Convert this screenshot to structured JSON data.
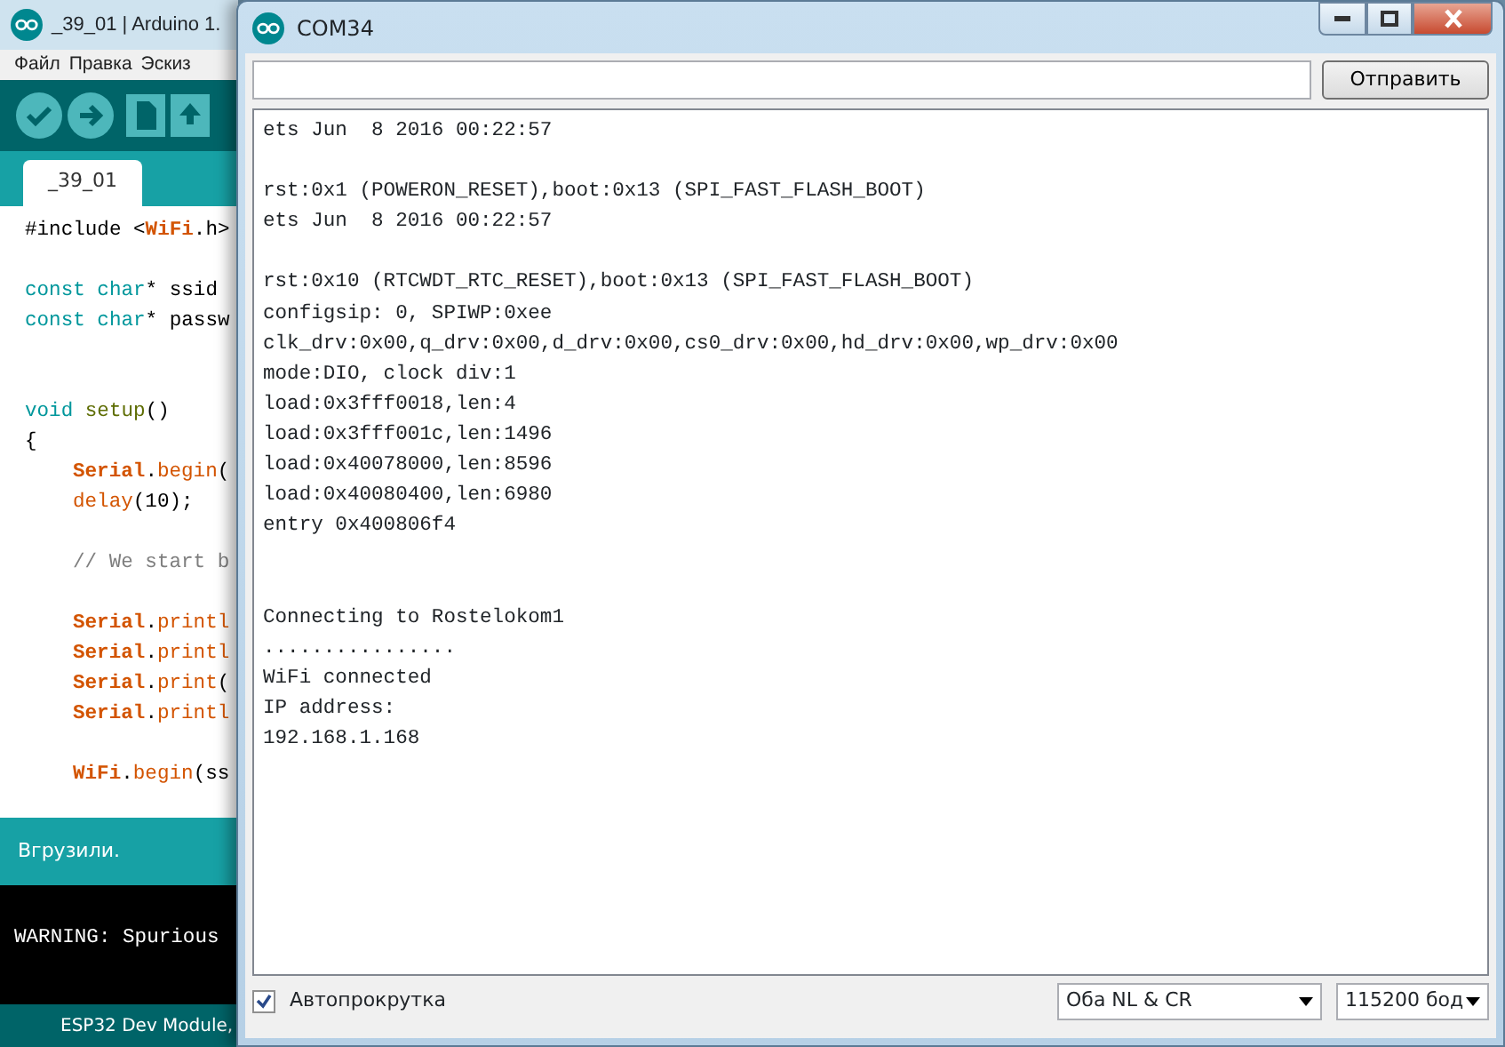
{
  "ide_window": {
    "title": "_39_01 | Arduino 1.",
    "menu": [
      "Файл",
      "Правка",
      "Эскиз"
    ],
    "tabs": [
      {
        "label": "_39_01",
        "selected": true
      }
    ],
    "code_lines": [
      {
        "kind": "code",
        "tokens": [
          {
            "text": "#include <",
            "kind": "plain"
          },
          {
            "text": "WiFi",
            "kind": "class"
          },
          {
            "text": ".h>",
            "kind": "plain"
          }
        ]
      },
      {
        "kind": "blank"
      },
      {
        "kind": "code",
        "tokens": [
          {
            "text": "const char",
            "kind": "keyword"
          },
          {
            "text": "* ssid",
            "kind": "plain"
          }
        ]
      },
      {
        "kind": "code",
        "tokens": [
          {
            "text": "const char",
            "kind": "keyword"
          },
          {
            "text": "* passw",
            "kind": "plain"
          }
        ]
      },
      {
        "kind": "blank"
      },
      {
        "kind": "blank"
      },
      {
        "kind": "code",
        "tokens": [
          {
            "text": "void",
            "kind": "keyword"
          },
          {
            "text": " setup",
            "kind": "function"
          },
          {
            "text": "()",
            "kind": "plain"
          }
        ]
      },
      {
        "kind": "code",
        "tokens": [
          {
            "text": "{",
            "kind": "plain"
          }
        ]
      },
      {
        "kind": "indented",
        "tokens": [
          {
            "text": "Serial",
            "kind": "class"
          },
          {
            "text": ".",
            "kind": "plain"
          },
          {
            "text": "begin",
            "kind": "method"
          },
          {
            "text": "(",
            "kind": "plain"
          }
        ]
      },
      {
        "kind": "indented",
        "tokens": [
          {
            "text": "delay",
            "kind": "method"
          },
          {
            "text": "(10);",
            "kind": "plain"
          }
        ]
      },
      {
        "kind": "blank"
      },
      {
        "kind": "indented",
        "tokens": [
          {
            "text": "// We start b",
            "kind": "comment"
          }
        ]
      },
      {
        "kind": "blank"
      },
      {
        "kind": "indented",
        "tokens": [
          {
            "text": "Serial",
            "kind": "class"
          },
          {
            "text": ".",
            "kind": "plain"
          },
          {
            "text": "printl",
            "kind": "method"
          }
        ]
      },
      {
        "kind": "indented",
        "tokens": [
          {
            "text": "Serial",
            "kind": "class"
          },
          {
            "text": ".",
            "kind": "plain"
          },
          {
            "text": "printl",
            "kind": "method"
          }
        ]
      },
      {
        "kind": "indented",
        "tokens": [
          {
            "text": "Serial",
            "kind": "class"
          },
          {
            "text": ".",
            "kind": "plain"
          },
          {
            "text": "print",
            "kind": "method"
          },
          {
            "text": "(",
            "kind": "plain"
          }
        ]
      },
      {
        "kind": "indented",
        "tokens": [
          {
            "text": "Serial",
            "kind": "class"
          },
          {
            "text": ".",
            "kind": "plain"
          },
          {
            "text": "printl",
            "kind": "method"
          }
        ]
      },
      {
        "kind": "blank"
      },
      {
        "kind": "indented",
        "tokens": [
          {
            "text": "WiFi",
            "kind": "class"
          },
          {
            "text": ".",
            "kind": "plain"
          },
          {
            "text": "begin",
            "kind": "method"
          },
          {
            "text": "(ss",
            "kind": "plain"
          }
        ]
      }
    ],
    "status": "Вгрузили.",
    "console_lines": [
      "WARNING: Spurious"
    ],
    "board": "ESP32 Dev Module,"
  },
  "serial_window": {
    "title": "COM34",
    "send_button": "Отправить",
    "output": [
      {
        "kind": "text",
        "text": "ets Jun  8 2016 00:22:57"
      },
      {
        "kind": "blank"
      },
      {
        "kind": "text",
        "text": "rst:0x1 (POWERON_RESET),boot:0x13 (SPI_FAST_FLASH_BOOT)"
      },
      {
        "kind": "text",
        "text": "ets Jun  8 2016 00:22:57"
      },
      {
        "kind": "blank"
      },
      {
        "kind": "text",
        "text": "rst:0x10 (RTCWDT_RTC_RESET),boot:0x13 (SPI_FAST_FLASH_BOOT)"
      },
      {
        "kind": "text",
        "text": "configsip: 0, SPIWP:0xee"
      },
      {
        "kind": "text",
        "text": "clk_drv:0x00,q_drv:0x00,d_drv:0x00,cs0_drv:0x00,hd_drv:0x00,wp_drv:0x00"
      },
      {
        "kind": "text",
        "text": "mode:DIO, clock div:1"
      },
      {
        "kind": "text",
        "text": "load:0x3fff0018,len:4"
      },
      {
        "kind": "text",
        "text": "load:0x3fff001c,len:1496"
      },
      {
        "kind": "text",
        "text": "load:0x40078000,len:8596"
      },
      {
        "kind": "text",
        "text": "load:0x40080400,len:6980"
      },
      {
        "kind": "text",
        "text": "entry 0x400806f4"
      },
      {
        "kind": "blank"
      },
      {
        "kind": "blank"
      },
      {
        "kind": "text",
        "text": "Connecting to Rostelokom1"
      },
      {
        "kind": "text",
        "text": "................"
      },
      {
        "kind": "text",
        "text": "WiFi connected"
      },
      {
        "kind": "text",
        "text": "IP address:"
      },
      {
        "kind": "text",
        "text": "192.168.1.168"
      }
    ],
    "autoscroll": {
      "label": "Автопрокрутка",
      "checked": true
    },
    "line_ending": "Оба NL & CR",
    "baud": "115200 бод"
  }
}
